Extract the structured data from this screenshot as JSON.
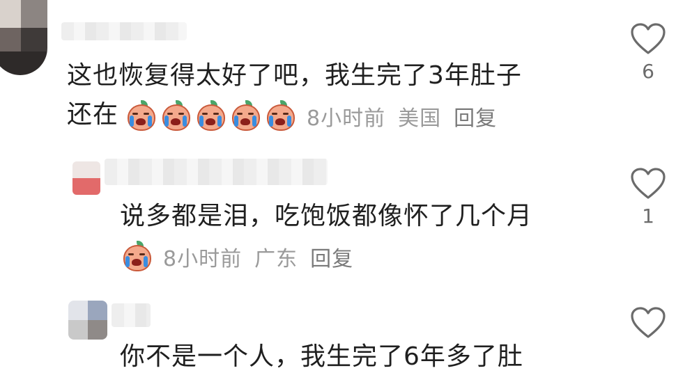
{
  "comments": [
    {
      "text_line1": "这也恢复得太好了吧，我生完了3年肚子",
      "text_line2": "还在",
      "time": "8小时前",
      "location": "美国",
      "reply_label": "回复",
      "likes": "6",
      "emoji_count": 5
    },
    {
      "text_line1": "说多都是泪，吃饱饭都像怀了几个月",
      "time": "8小时前",
      "location": "广东",
      "reply_label": "回复",
      "likes": "1",
      "emoji_count": 1
    },
    {
      "text_line1": "你不是一个人，我生完了6年多了肚",
      "likes": ""
    }
  ],
  "icons": {
    "like": "heart-outline-icon",
    "emoji": "crying-peach-emoji-icon"
  },
  "colors": {
    "text": "#1f1f1f",
    "meta": "#9a9a9a",
    "heart": "#6b6b6b"
  }
}
